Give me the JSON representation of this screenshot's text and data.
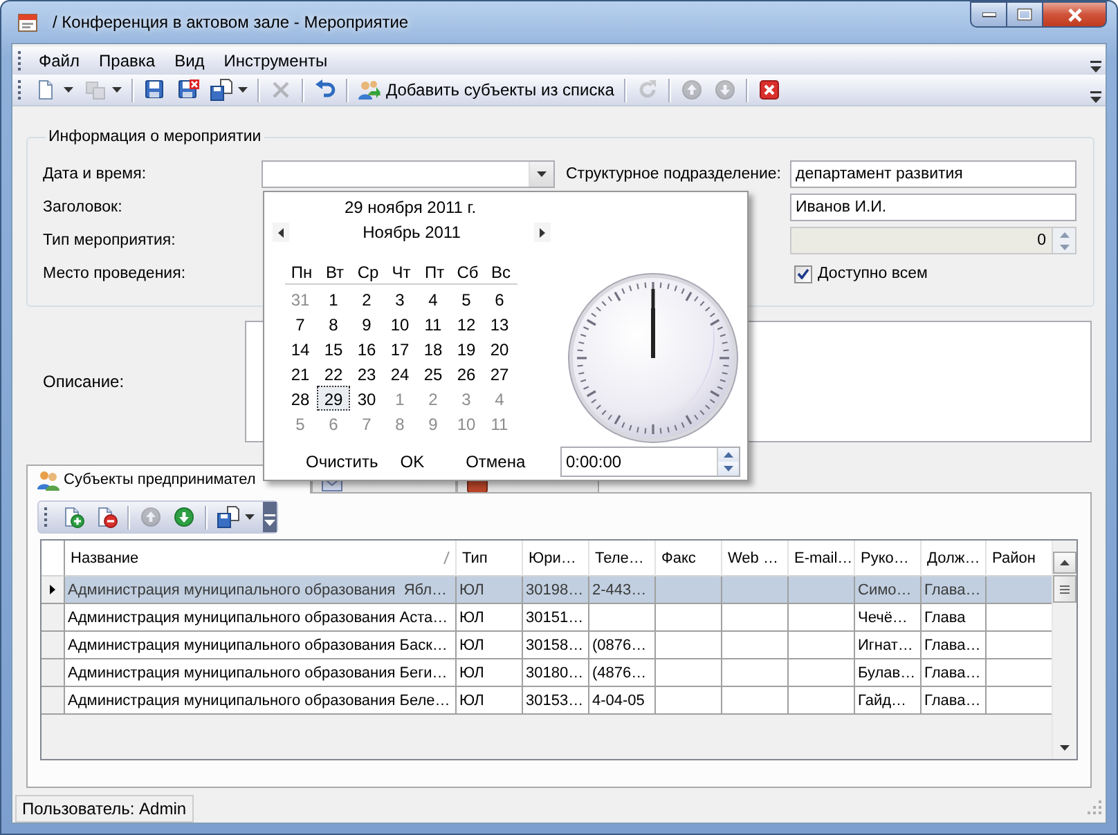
{
  "window": {
    "title": "/ Конференция в актовом зале - Мероприятие"
  },
  "menu": [
    "Файл",
    "Правка",
    "Вид",
    "Инструменты"
  ],
  "toolbar": [
    {
      "kind": "new",
      "disabled": false,
      "dropdown": true
    },
    {
      "kind": "copy",
      "disabled": true,
      "dropdown": true
    },
    {
      "kind": "separator"
    },
    {
      "kind": "save",
      "disabled": false,
      "dropdown": false
    },
    {
      "kind": "save-close",
      "disabled": false,
      "dropdown": false
    },
    {
      "kind": "export",
      "disabled": false,
      "dropdown": true
    },
    {
      "kind": "separator"
    },
    {
      "kind": "delete",
      "disabled": true,
      "dropdown": false
    },
    {
      "kind": "separator"
    },
    {
      "kind": "undo",
      "disabled": false,
      "dropdown": false
    },
    {
      "kind": "separator"
    },
    {
      "kind": "add-list",
      "disabled": false,
      "dropdown": false,
      "label": "Добавить субъекты из списка"
    },
    {
      "kind": "separator"
    },
    {
      "kind": "refresh",
      "disabled": true,
      "dropdown": false
    },
    {
      "kind": "separator"
    },
    {
      "kind": "up",
      "disabled": true,
      "dropdown": false
    },
    {
      "kind": "down",
      "disabled": true,
      "dropdown": false
    },
    {
      "kind": "separator"
    },
    {
      "kind": "close",
      "disabled": false,
      "dropdown": false
    }
  ],
  "event_info": {
    "legend": "Информация о мероприятии",
    "date": {
      "label": "Дата и время:"
    },
    "division": {
      "label": "Структурное подразделение:",
      "value": "департамент развития"
    },
    "heading_label": "Заголовок:",
    "responsible": {
      "value": "Иванов И.И."
    },
    "type_label": "Тип мероприятия:",
    "counter": {
      "value": "0",
      "disabled": true
    },
    "place_label": "Место проведения:",
    "public": {
      "label": "Доступно всем",
      "checked": true
    }
  },
  "description": {
    "label": "Описание:"
  },
  "tabs": [
    {
      "label": "Субъекты предпринимател",
      "selected": true
    },
    {
      "selected": false
    },
    {
      "selected": false
    }
  ],
  "grid_toolbar": [
    {
      "kind": "add-row",
      "disabled": false,
      "dropdown": false
    },
    {
      "kind": "remove-row",
      "disabled": false,
      "dropdown": false
    },
    {
      "kind": "separator"
    },
    {
      "kind": "up",
      "disabled": true,
      "dropdown": false
    },
    {
      "kind": "down",
      "disabled": false,
      "dropdown": false
    },
    {
      "kind": "separator"
    },
    {
      "kind": "export",
      "disabled": false,
      "dropdown": true
    }
  ],
  "grid": {
    "columns": [
      {
        "label": "Название",
        "sorted": true
      },
      {
        "label": "Тип",
        "sorted": false
      },
      {
        "label": "Юри…",
        "sorted": false
      },
      {
        "label": "Теле…",
        "sorted": false
      },
      {
        "label": "Факс",
        "sorted": false
      },
      {
        "label": "Web …",
        "sorted": false
      },
      {
        "label": "E-mail…",
        "sorted": false
      },
      {
        "label": "Руко…",
        "sorted": false
      },
      {
        "label": "Долж…",
        "sorted": false
      },
      {
        "label": "Район",
        "sorted": false
      }
    ],
    "rows": [
      {
        "selected": true,
        "cells": [
          "Администрация муниципального образования  Ябл…",
          "ЮЛ",
          "30198…",
          "2-443…",
          null,
          null,
          null,
          "Симо…",
          "Глава…",
          null
        ]
      },
      {
        "selected": false,
        "cells": [
          "Администрация муниципального образования Аста…",
          "ЮЛ",
          "30151…",
          null,
          null,
          null,
          null,
          "Чечё…",
          "Глава",
          null
        ]
      },
      {
        "selected": false,
        "cells": [
          "Администрация муниципального образования Баск…",
          "ЮЛ",
          "30158…",
          "(0876…",
          null,
          null,
          null,
          "Игнат…",
          "Глава…",
          null
        ]
      },
      {
        "selected": false,
        "cells": [
          "Администрация муниципального образования Беги…",
          "ЮЛ",
          "30180…",
          "(4876…",
          null,
          null,
          null,
          "Булав…",
          "Глава…",
          null
        ]
      },
      {
        "selected": false,
        "cells": [
          "Администрация муниципального образования Беле…",
          "ЮЛ",
          "30153…",
          "4-04-05",
          null,
          null,
          null,
          "Гайд…",
          "Глава…",
          null
        ]
      }
    ]
  },
  "calendar": {
    "date_title": "29 ноября 2011 г.",
    "month": "Ноябрь 2011",
    "weekdays": [
      "Пн",
      "Вт",
      "Ср",
      "Чт",
      "Пт",
      "Сб",
      "Вс"
    ],
    "days": [
      {
        "label": "31",
        "other": true,
        "selected": false
      },
      {
        "label": "1",
        "other": false,
        "selected": false
      },
      {
        "label": "2",
        "other": false,
        "selected": false
      },
      {
        "label": "3",
        "other": false,
        "selected": false
      },
      {
        "label": "4",
        "other": false,
        "selected": false
      },
      {
        "label": "5",
        "other": false,
        "selected": false
      },
      {
        "label": "6",
        "other": false,
        "selected": false
      },
      {
        "label": "7",
        "other": false,
        "selected": false
      },
      {
        "label": "8",
        "other": false,
        "selected": false
      },
      {
        "label": "9",
        "other": false,
        "selected": false
      },
      {
        "label": "10",
        "other": false,
        "selected": false
      },
      {
        "label": "11",
        "other": false,
        "selected": false
      },
      {
        "label": "12",
        "other": false,
        "selected": false
      },
      {
        "label": "13",
        "other": false,
        "selected": false
      },
      {
        "label": "14",
        "other": false,
        "selected": false
      },
      {
        "label": "15",
        "other": false,
        "selected": false
      },
      {
        "label": "16",
        "other": false,
        "selected": false
      },
      {
        "label": "17",
        "other": false,
        "selected": false
      },
      {
        "label": "18",
        "other": false,
        "selected": false
      },
      {
        "label": "19",
        "other": false,
        "selected": false
      },
      {
        "label": "20",
        "other": false,
        "selected": false
      },
      {
        "label": "21",
        "other": false,
        "selected": false
      },
      {
        "label": "22",
        "other": false,
        "selected": false
      },
      {
        "label": "23",
        "other": false,
        "selected": false
      },
      {
        "label": "24",
        "other": false,
        "selected": false
      },
      {
        "label": "25",
        "other": false,
        "selected": false
      },
      {
        "label": "26",
        "other": false,
        "selected": false
      },
      {
        "label": "27",
        "other": false,
        "selected": false
      },
      {
        "label": "28",
        "other": false,
        "selected": false
      },
      {
        "label": "29",
        "other": false,
        "selected": true
      },
      {
        "label": "30",
        "other": false,
        "selected": false
      },
      {
        "label": "1",
        "other": true,
        "selected": false
      },
      {
        "label": "2",
        "other": true,
        "selected": false
      },
      {
        "label": "3",
        "other": true,
        "selected": false
      },
      {
        "label": "4",
        "other": true,
        "selected": false
      },
      {
        "label": "5",
        "other": true,
        "selected": false
      },
      {
        "label": "6",
        "other": true,
        "selected": false
      },
      {
        "label": "7",
        "other": true,
        "selected": false
      },
      {
        "label": "8",
        "other": true,
        "selected": false
      },
      {
        "label": "9",
        "other": true,
        "selected": false
      },
      {
        "label": "10",
        "other": true,
        "selected": false
      },
      {
        "label": "11",
        "other": true,
        "selected": false
      }
    ],
    "buttons": [
      "Очистить",
      "OK",
      "Отмена"
    ],
    "time": "0:00:00"
  },
  "status_bar": {
    "user": "Пользователь: Admin"
  }
}
